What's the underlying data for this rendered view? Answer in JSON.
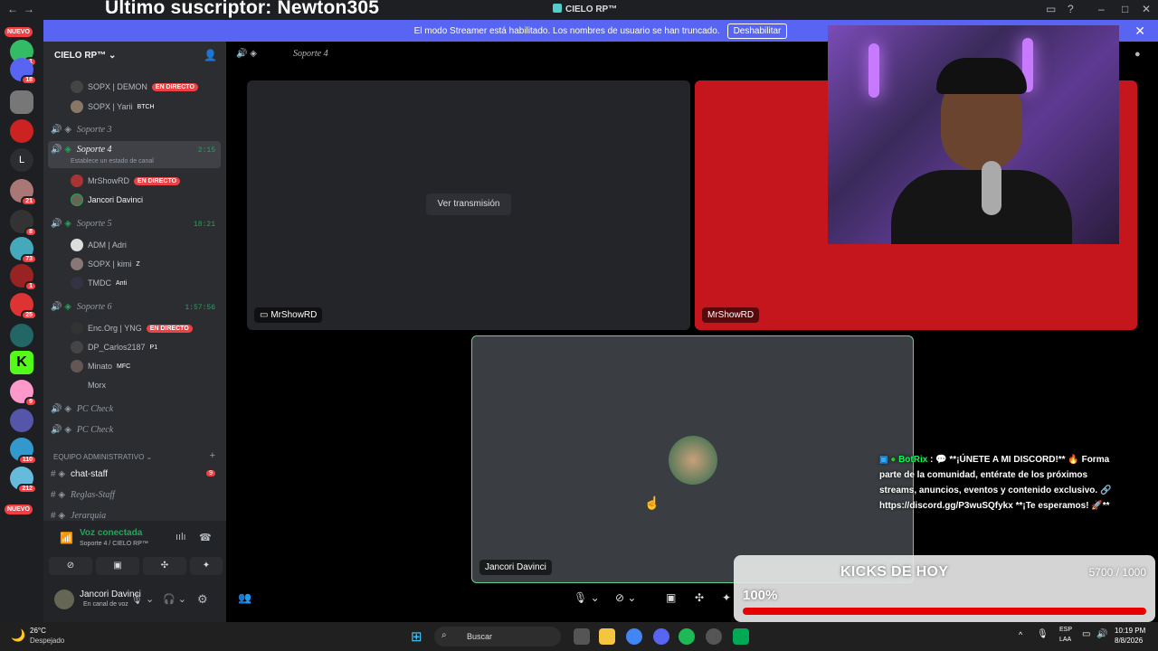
{
  "overlay_title": "Último suscriptor: Newton305",
  "app_title": "CIELO RP™",
  "banner": {
    "text": "El modo Streamer está habilitado. Los nombres de usuario se han truncado.",
    "button": "Deshabilitar"
  },
  "rail": {
    "nuevo_top": "NUEVO",
    "nuevo_bottom": "NUEVO",
    "badges": [
      "1",
      "18",
      "21",
      "8",
      "73",
      "1",
      "25",
      "9",
      "110",
      "212"
    ],
    "letter": "L"
  },
  "sidebar": {
    "server_name": "CIELO RP™",
    "users_top": [
      {
        "name": "SOPX | DEMON",
        "tag": "EN DIRECTO"
      },
      {
        "name": "SOPX | Yarii",
        "tag": "BTCH"
      }
    ],
    "channels": {
      "soporte3": "Soporte 3",
      "soporte4": "Soporte 4",
      "soporte4_time": "2:15",
      "soporte4_status": "Establece un estado de canal",
      "soporte5": "Soporte 5",
      "soporte5_time": "18:21",
      "soporte6": "Soporte 6",
      "soporte6_time": "1:57:56",
      "pccheck1": "PC Check",
      "pccheck2": "PC Check"
    },
    "soporte4_users": [
      {
        "name": "MrShowRD",
        "tag": "EN DIRECTO"
      },
      {
        "name": "Jancori Davinci"
      }
    ],
    "soporte5_users": [
      {
        "name": "ADM | Adri"
      },
      {
        "name": "SOPX | kimi",
        "tag": "Z"
      },
      {
        "name": "TMDC",
        "tag": "Anti"
      }
    ],
    "soporte6_users": [
      {
        "name": "Enc.Org | YNG",
        "tag": "EN DIRECTO"
      },
      {
        "name": "DP_Carlos2187",
        "tag": "P1"
      },
      {
        "name": "Minato",
        "tag": "MFC"
      },
      {
        "name": "Morx"
      }
    ],
    "category": "EQUIPO ADMINISTRATIVO",
    "text_channels": [
      {
        "name": "chat-staff",
        "badge": "9"
      },
      {
        "name": "Reglas-Staff"
      },
      {
        "name": "Jerarquia"
      }
    ]
  },
  "voice": {
    "connected": "Voz conectada",
    "location": "Soporte 4 / CIELO RP™",
    "user": "Jancori Davinci",
    "status": "En canal de voz"
  },
  "stage": {
    "title": "Soporte 4",
    "watch_button": "Ver transmisión",
    "tile1_label": "MrShowRD",
    "tile2_label": "MrShowRD",
    "tile3_label": "Jancori Davinci"
  },
  "chat": {
    "author": "BotRix",
    "message": "💬 **¡ÚNETE A MI DISCORD!** 🔥 Forma parte de la comunidad, entérate de los próximos streams, anuncios, eventos y contenido exclusivo. 🔗 https://discord.gg/P3wuSQfykx **¡Te esperamos! 🚀**"
  },
  "kicks": {
    "title": "KICKS DE HOY",
    "count": "5700 / 1000",
    "percent_label": "100%",
    "progress": 1.0
  },
  "taskbar": {
    "temp": "26°C",
    "weather": "Despejado",
    "search": "Buscar",
    "lang1": "ESP",
    "lang2": "LAA",
    "time": "10:19 PM",
    "date": "8/8/2026"
  },
  "colors": {
    "accent": "#5865f2",
    "live": "#ed4245",
    "online": "#23a55a",
    "kick_red": "#e60000"
  }
}
